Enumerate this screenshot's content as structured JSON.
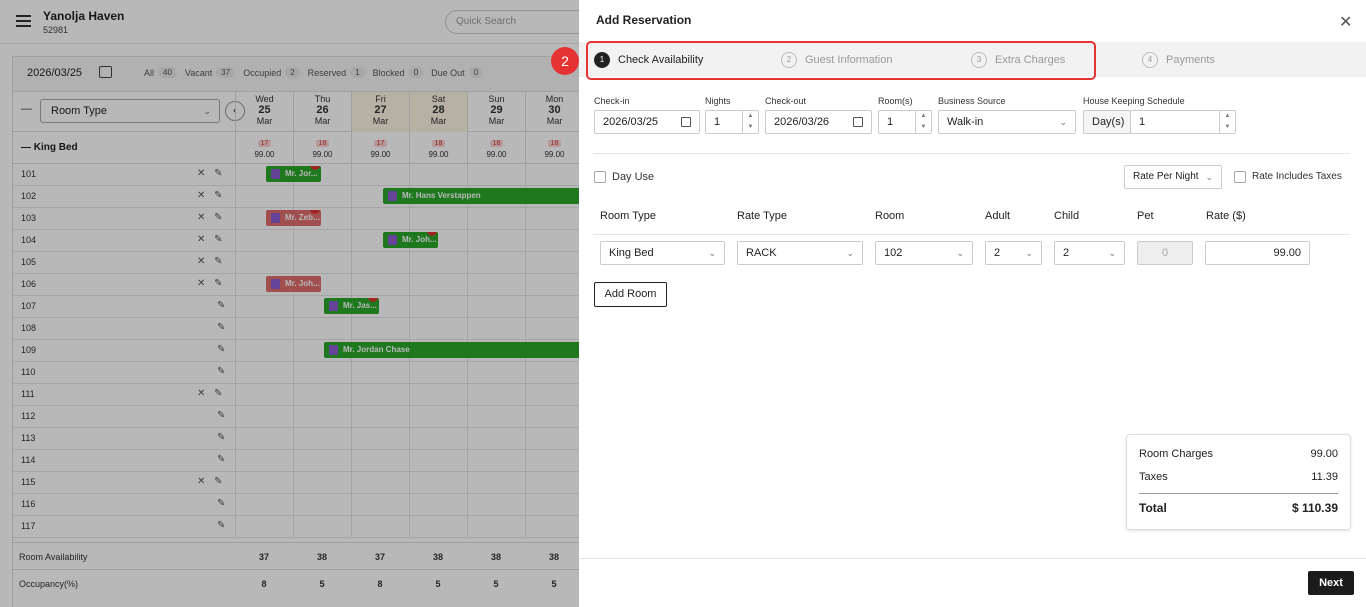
{
  "app": {
    "hotel_name": "Yanolja Haven",
    "hotel_id": "52981",
    "quick_search_placeholder": "Quick Search"
  },
  "calendar": {
    "date": "2026/03/25",
    "filters": [
      {
        "label": "All",
        "count": "40"
      },
      {
        "label": "Vacant",
        "count": "37"
      },
      {
        "label": "Occupied",
        "count": "2"
      },
      {
        "label": "Reserved",
        "count": "1"
      },
      {
        "label": "Blocked",
        "count": "0"
      },
      {
        "label": "Due Out",
        "count": "0"
      }
    ],
    "room_type_label": "Room Type",
    "dash": "—",
    "days": [
      {
        "dow": "Wed",
        "day": "25",
        "mon": "Mar"
      },
      {
        "dow": "Thu",
        "day": "26",
        "mon": "Mar"
      },
      {
        "dow": "Fri",
        "day": "27",
        "mon": "Mar"
      },
      {
        "dow": "Sat",
        "day": "28",
        "mon": "Mar"
      },
      {
        "dow": "Sun",
        "day": "29",
        "mon": "Mar"
      },
      {
        "dow": "Mon",
        "day": "30",
        "mon": "Mar"
      }
    ],
    "category": {
      "name": "King Bed",
      "avail": [
        "17",
        "18",
        "17",
        "18",
        "18",
        "18"
      ],
      "price": [
        "99.00",
        "99.00",
        "99.00",
        "99.00",
        "99.00",
        "99.00"
      ]
    },
    "rooms": [
      "101",
      "102",
      "103",
      "104",
      "105",
      "106",
      "107",
      "108",
      "109",
      "110",
      "111",
      "112",
      "113",
      "114",
      "115",
      "116",
      "117"
    ],
    "bookings": [
      {
        "name": "Mr. Jor..."
      },
      {
        "name": "Mr. Hans Verstappen"
      },
      {
        "name": "Mr. Zeb..."
      },
      {
        "name": "Mr. Joh..."
      },
      {
        "name": "Mr. Joh..."
      },
      {
        "name": "Mr. Jas..."
      },
      {
        "name": "Mr. Jordan Chase"
      }
    ],
    "booking_dot": "S",
    "footer": {
      "availability_label": "Room Availability",
      "availability": [
        "37",
        "38",
        "37",
        "38",
        "38",
        "38"
      ],
      "occupancy_label": "Occupancy(%)",
      "occupancy": [
        "8",
        "5",
        "8",
        "5",
        "5",
        "5"
      ]
    }
  },
  "modal": {
    "title": "Add Reservation",
    "close": "✕",
    "annotation_number": "2",
    "steps": [
      {
        "num": "1",
        "label": "Check Availability"
      },
      {
        "num": "2",
        "label": "Guest Information"
      },
      {
        "num": "3",
        "label": "Extra Charges"
      },
      {
        "num": "4",
        "label": "Payments"
      }
    ],
    "fields": {
      "checkin_label": "Check-in",
      "checkin": "2026/03/25",
      "nights_label": "Nights",
      "nights": "1",
      "checkout_label": "Check-out",
      "checkout": "2026/03/26",
      "rooms_label": "Room(s)",
      "rooms": "1",
      "source_label": "Business Source",
      "source": "Walk-in",
      "hk_label": "House Keeping Schedule",
      "hk_unit": "Day(s)",
      "hk_value": "1"
    },
    "day_use_label": "Day Use",
    "rate_mode": "Rate Per Night",
    "rate_includes_taxes_label": "Rate Includes Taxes",
    "table": {
      "headers": [
        "Room Type",
        "Rate Type",
        "Room",
        "Adult",
        "Child",
        "Pet",
        "Rate ($)"
      ],
      "row": {
        "room_type": "King Bed",
        "rate_type": "RACK",
        "room": "102",
        "adult": "2",
        "child": "2",
        "pet": "0",
        "rate": "99.00"
      }
    },
    "add_room": "Add Room",
    "summary": {
      "room_charges_label": "Room Charges",
      "room_charges": "99.00",
      "taxes_label": "Taxes",
      "taxes": "11.39",
      "total_label": "Total",
      "total": "$ 110.39"
    },
    "next": "Next"
  }
}
